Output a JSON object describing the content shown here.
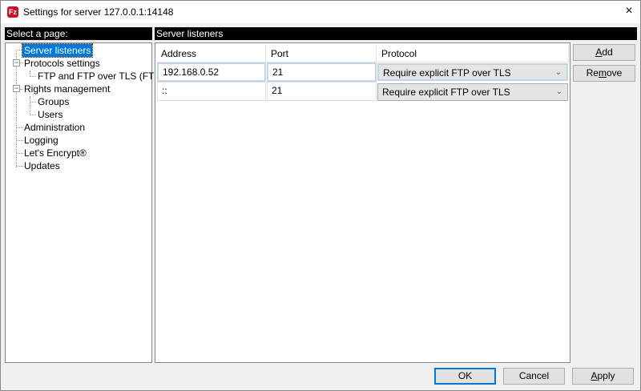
{
  "window": {
    "title": "Settings for server 127.0.0.1:14148",
    "close_icon": "×"
  },
  "left": {
    "header": "Select a page:",
    "tree": [
      {
        "label": "Server listeners",
        "selected": true
      },
      {
        "label": "Protocols settings"
      },
      {
        "label": "FTP and FTP over TLS (FTPS)"
      },
      {
        "label": "Rights management"
      },
      {
        "label": "Groups"
      },
      {
        "label": "Users"
      },
      {
        "label": "Administration"
      },
      {
        "label": "Logging"
      },
      {
        "label": "Let's Encrypt®"
      },
      {
        "label": "Updates"
      }
    ]
  },
  "right": {
    "header": "Server listeners",
    "columns": [
      "Address",
      "Port",
      "Protocol"
    ],
    "rows": [
      {
        "address": "192.168.0.52",
        "port": "21",
        "protocol": "Require explicit FTP over TLS"
      },
      {
        "address": "::",
        "port": "21",
        "protocol": "Require explicit FTP over TLS"
      }
    ],
    "add": {
      "pre": "",
      "u": "A",
      "post": "dd"
    },
    "remove": {
      "pre": "Re",
      "u": "m",
      "post": "ove"
    }
  },
  "footer": {
    "ok": "OK",
    "cancel": "Cancel",
    "apply": {
      "u": "A",
      "post": "pply"
    }
  }
}
